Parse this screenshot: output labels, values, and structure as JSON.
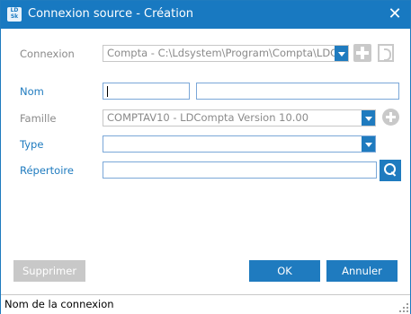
{
  "window": {
    "title": "Connexion source - Création",
    "app_icon_text": "LD\nSk"
  },
  "form": {
    "connexion": {
      "label": "Connexion",
      "value": "Compta - C:\\Ldsystem\\Program\\Compta\\LDCParam"
    },
    "nom": {
      "label": "Nom",
      "value1": "",
      "value2": ""
    },
    "famille": {
      "label": "Famille",
      "value": "COMPTAV10 - LDCompta Version 10.00"
    },
    "type": {
      "label": "Type",
      "value": ""
    },
    "repertoire": {
      "label": "Répertoire",
      "value": ""
    }
  },
  "buttons": {
    "delete": "Supprimer",
    "ok": "OK",
    "cancel": "Annuler"
  },
  "status": {
    "text": "Nom de la connexion"
  },
  "colors": {
    "accent": "#1879c1",
    "required_label": "#1f7bbf",
    "muted": "#8a8a8a"
  },
  "icons": {
    "close": "close-icon",
    "search": "search-icon",
    "add": "plus-icon",
    "details": "document-icon"
  }
}
